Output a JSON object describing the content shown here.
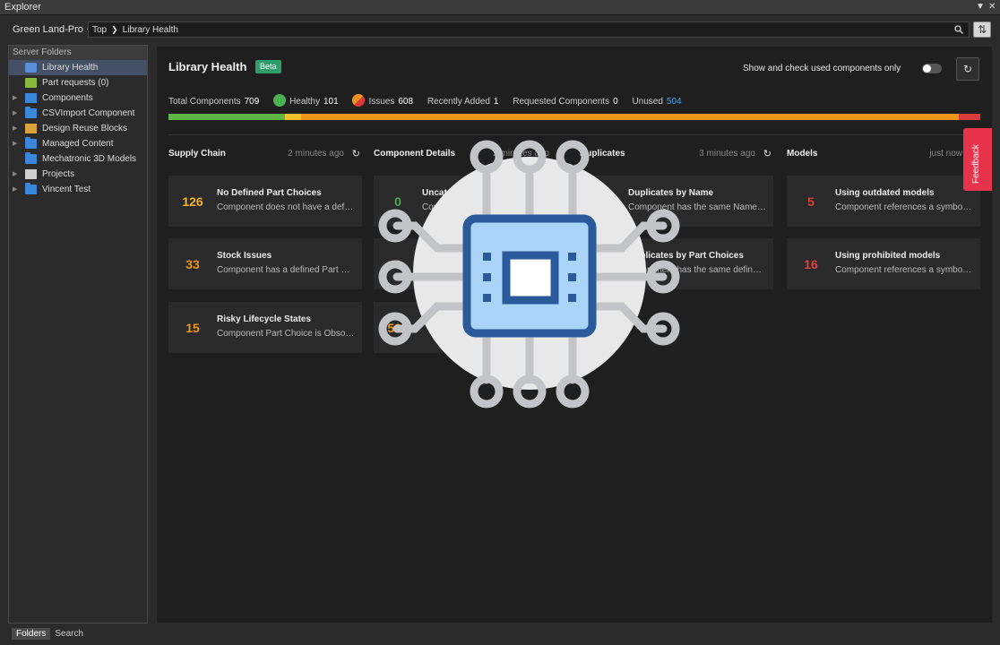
{
  "window": {
    "title": "Explorer"
  },
  "pathbar": {
    "server": "Green Land-Pro",
    "crumbs": [
      "Top",
      "Library Health"
    ]
  },
  "sidebar": {
    "header": "Server Folders",
    "items": [
      {
        "label": "Library Health",
        "selected": true,
        "has_arrow": false,
        "icon": "library-health-icon"
      },
      {
        "label": "Part requests (0)",
        "selected": false,
        "has_arrow": false,
        "icon": "part-request-icon"
      },
      {
        "label": "Components",
        "selected": false,
        "has_arrow": true,
        "icon": "components-icon"
      },
      {
        "label": "CSVImport Component",
        "selected": false,
        "has_arrow": true,
        "icon": "folder-icon"
      },
      {
        "label": "Design Reuse Blocks",
        "selected": false,
        "has_arrow": true,
        "icon": "reuse-blocks-icon"
      },
      {
        "label": "Managed Content",
        "selected": false,
        "has_arrow": true,
        "icon": "folder-icon"
      },
      {
        "label": "Mechatronic 3D Models",
        "selected": false,
        "has_arrow": false,
        "icon": "folder-icon"
      },
      {
        "label": "Projects",
        "selected": false,
        "has_arrow": true,
        "icon": "projects-icon"
      },
      {
        "label": "Vincent Test",
        "selected": false,
        "has_arrow": true,
        "icon": "folder-icon"
      }
    ],
    "tabs": [
      "Folders",
      "Search"
    ]
  },
  "main": {
    "title": "Library Health",
    "badge": "Beta",
    "used_toggle_label": "Show and check used components only",
    "stats": {
      "total_label": "Total Components",
      "total": "709",
      "healthy_label": "Healthy",
      "healthy": "101",
      "issues_label": "Issues",
      "issues": "608",
      "recent_label": "Recently Added",
      "recent": "1",
      "requested_label": "Requested Components",
      "requested": "0",
      "unused_label": "Unused",
      "unused": "504"
    },
    "health_bar": [
      {
        "fraction": 0.143,
        "color": "#5fb546"
      },
      {
        "fraction": 0.02,
        "color": "#f2c12e"
      },
      {
        "fraction": 0.81,
        "color": "#f0961c"
      },
      {
        "fraction": 0.027,
        "color": "#d93b3b"
      }
    ],
    "columns": [
      {
        "name": "Supply Chain",
        "time": "2 minutes ago",
        "cards": [
          {
            "num": "126",
            "color": "#f5b325",
            "title": "No Defined Part Choices",
            "desc": "Component does not have a defined Part Choice"
          },
          {
            "num": "33",
            "color": "#f0961c",
            "title": "Stock Issues",
            "desc": "Component has a defined Part Choice with stock issues"
          },
          {
            "num": "15",
            "color": "#f0961c",
            "title": "Risky Lifecycle States",
            "desc": "Component Part Choice is Obsolete"
          }
        ]
      },
      {
        "name": "Component Details",
        "time": "2 minutes ago",
        "cards": [
          {
            "num": "0",
            "color": "#4caf50",
            "title": "Uncategorized",
            "desc": "Component is not categorized"
          },
          {
            "num": "0",
            "color": "#f0961c",
            "title": "",
            "desc": ""
          },
          {
            "num": "505",
            "color": "#f0961c",
            "title": "",
            "desc": ""
          }
        ]
      },
      {
        "name": "Duplicates",
        "time": "3 minutes ago",
        "cards": [
          {
            "num": "",
            "color": "#f0961c",
            "title": "Duplicates by Name",
            "desc": "Component has the same Name as another"
          },
          {
            "num": "",
            "color": "#f0961c",
            "title": "Duplicates by Part Choices",
            "desc": "Component has the same defined Part Choices"
          }
        ]
      },
      {
        "name": "Models",
        "time": "just now",
        "cards": [
          {
            "num": "5",
            "color": "#e0413a",
            "title": "Using outdated models",
            "desc": "Component references a symbol or footprint that is outdated"
          },
          {
            "num": "16",
            "color": "#e0413a",
            "title": "Using prohibited models",
            "desc": "Component references a symbol or footprint that is prohibited"
          }
        ]
      }
    ],
    "feedback_label": "Feedback"
  },
  "colors": {
    "accent_blue": "#45a6e6",
    "healthy_green": "#4caf50",
    "issues_orange": "#f0961c",
    "feedback_red": "#e8334d",
    "beta_green": "#2e9d6a"
  }
}
